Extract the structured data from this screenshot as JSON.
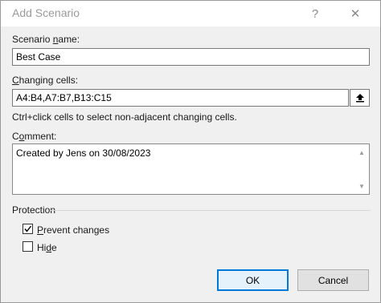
{
  "window": {
    "title": "Add Scenario",
    "help_glyph": "?",
    "close_glyph": "✕"
  },
  "scenario_name": {
    "label_pre": "Scenario ",
    "label_u": "n",
    "label_post": "ame:",
    "value": "Best Case"
  },
  "changing_cells": {
    "label_pre": "",
    "label_u": "C",
    "label_post": "hanging cells:",
    "value": "A4:B4,A7:B7,B13:C15",
    "hint": "Ctrl+click cells to select non-adjacent changing cells."
  },
  "comment": {
    "label_pre": "C",
    "label_u": "o",
    "label_post": "mment:",
    "value": "Created by Jens on 30/08/2023"
  },
  "protection": {
    "label": "Protection",
    "prevent_changes": {
      "label_pre": "",
      "label_u": "P",
      "label_post": "revent changes",
      "checked": true
    },
    "hide": {
      "label_pre": "Hi",
      "label_u": "d",
      "label_post": "e",
      "checked": false
    }
  },
  "buttons": {
    "ok": "OK",
    "cancel": "Cancel"
  },
  "icons": {
    "ref": "collapse-dialog-arrow-icon",
    "check": "checkmark-icon"
  }
}
